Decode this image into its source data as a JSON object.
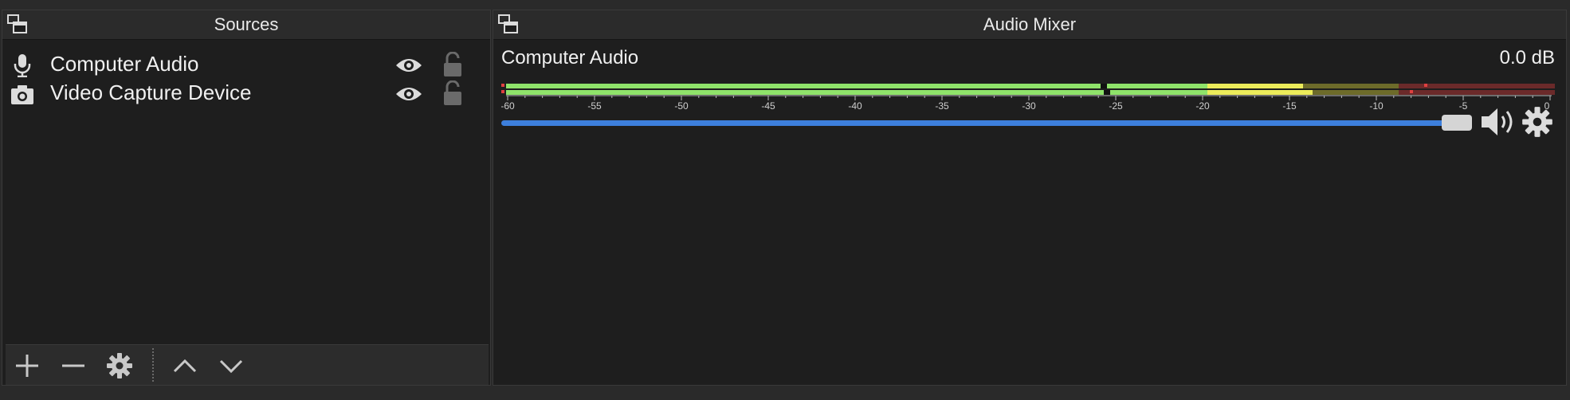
{
  "sources": {
    "title": "Sources",
    "items": [
      {
        "label": "Computer Audio",
        "icon": "microphone-icon",
        "visible": true,
        "locked": false
      },
      {
        "label": "Video Capture Device",
        "icon": "camera-icon",
        "visible": true,
        "locked": false
      }
    ],
    "toolbar": [
      "add-icon",
      "remove-icon",
      "gear-icon",
      "move-up-icon",
      "move-down-icon"
    ]
  },
  "mixer": {
    "title": "Audio Mixer",
    "channel": {
      "name": "Computer Audio",
      "db": "0.0 dB",
      "scale_labels": [
        "-60",
        "-55",
        "-50",
        "-45",
        "-40",
        "-35",
        "-30",
        "-25",
        "-20",
        "-15",
        "-10",
        "-5",
        "0"
      ],
      "volume_fraction": 1.0
    }
  },
  "colors": {
    "accent": "#3d7fdc",
    "meter_green": "#8fe36a",
    "meter_yellow": "#ecec5a",
    "meter_red_dim": "#6b2a2a"
  }
}
